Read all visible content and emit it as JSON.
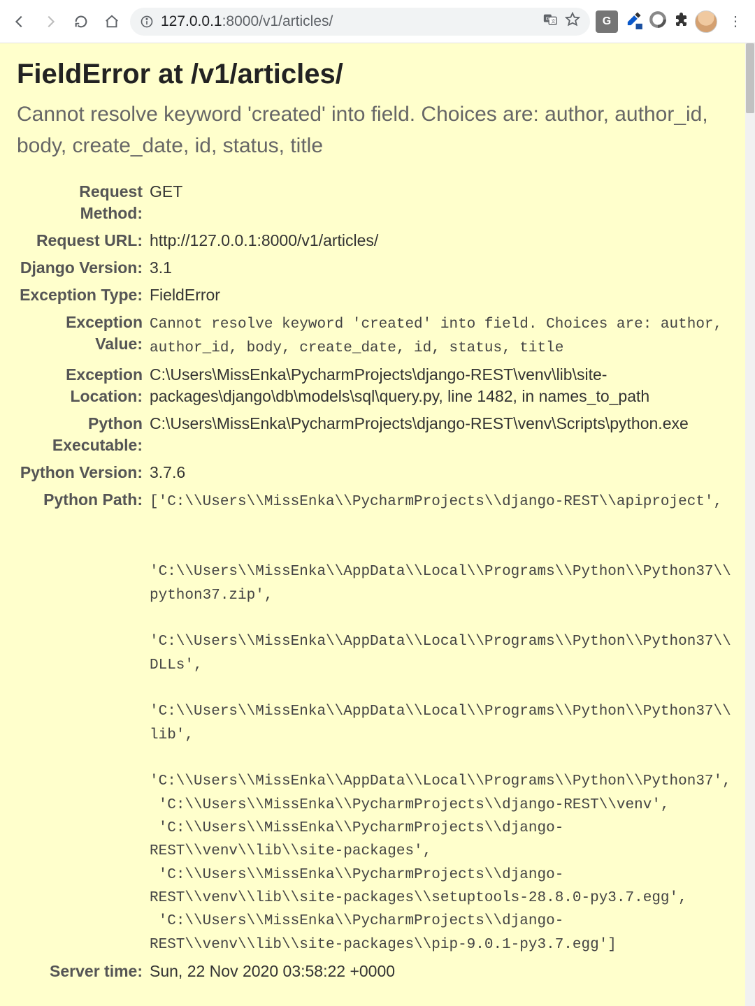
{
  "browser": {
    "url_ip": "127.0.0.1",
    "url_port_path": ":8000/v1/articles/"
  },
  "page": {
    "title": "FieldError at /v1/articles/",
    "subtitle": "Cannot resolve keyword 'created' into field. Choices are: author, author_id, body, create_date, id, status, title",
    "rows": {
      "request_method": {
        "label": "Request Method:",
        "value": "GET"
      },
      "request_url": {
        "label": "Request URL:",
        "value": "http://127.0.0.1:8000/v1/articles/"
      },
      "django_version": {
        "label": "Django Version:",
        "value": "3.1"
      },
      "exception_type": {
        "label": "Exception Type:",
        "value": "FieldError"
      },
      "exception_value": {
        "label": "Exception Value:",
        "value": "Cannot resolve keyword 'created' into field. Choices are: author, author_id, body, create_date, id, status, title"
      },
      "exception_location": {
        "label": "Exception Location:",
        "value": "C:\\Users\\MissEnka\\PycharmProjects\\django-REST\\venv\\lib\\site-packages\\django\\db\\models\\sql\\query.py, line 1482, in names_to_path"
      },
      "python_executable": {
        "label": "Python Executable:",
        "value": "C:\\Users\\MissEnka\\PycharmProjects\\django-REST\\venv\\Scripts\\python.exe"
      },
      "python_version": {
        "label": "Python Version:",
        "value": "3.7.6"
      },
      "python_path": {
        "label": "Python Path:",
        "value": "['C:\\\\Users\\\\MissEnka\\\\PycharmProjects\\\\django-REST\\\\apiproject',\n\n 'C:\\\\Users\\\\MissEnka\\\\AppData\\\\Local\\\\Programs\\\\Python\\\\Python37\\\\python37.zip',\n 'C:\\\\Users\\\\MissEnka\\\\AppData\\\\Local\\\\Programs\\\\Python\\\\Python37\\\\DLLs',\n 'C:\\\\Users\\\\MissEnka\\\\AppData\\\\Local\\\\Programs\\\\Python\\\\Python37\\\\lib',\n 'C:\\\\Users\\\\MissEnka\\\\AppData\\\\Local\\\\Programs\\\\Python\\\\Python37',\n 'C:\\\\Users\\\\MissEnka\\\\PycharmProjects\\\\django-REST\\\\venv',\n 'C:\\\\Users\\\\MissEnka\\\\PycharmProjects\\\\django-REST\\\\venv\\\\lib\\\\site-packages',\n 'C:\\\\Users\\\\MissEnka\\\\PycharmProjects\\\\django-REST\\\\venv\\\\lib\\\\site-packages\\\\setuptools-28.8.0-py3.7.egg',\n 'C:\\\\Users\\\\MissEnka\\\\PycharmProjects\\\\django-REST\\\\venv\\\\lib\\\\site-packages\\\\pip-9.0.1-py3.7.egg']"
      },
      "server_time": {
        "label": "Server time:",
        "value": "Sun, 22 Nov 2020 03:58:22 +0000"
      }
    }
  }
}
